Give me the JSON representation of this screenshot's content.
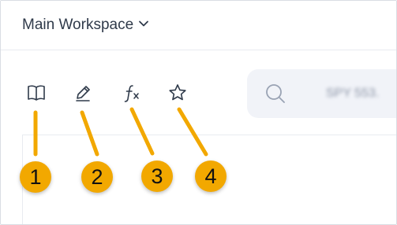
{
  "header": {
    "workspace_label": "Main Workspace"
  },
  "toolbar": {
    "icons": [
      "book-icon",
      "pencil-icon",
      "function-icon",
      "star-icon"
    ]
  },
  "search": {
    "value": "SPY 553."
  },
  "callouts": {
    "labels": [
      "1",
      "2",
      "3",
      "4"
    ]
  },
  "colors": {
    "callout_fill": "#f2a800",
    "icon_stroke": "#2f3a4a",
    "search_bg": "#f1f3f8",
    "text": "#2f3a4a"
  }
}
